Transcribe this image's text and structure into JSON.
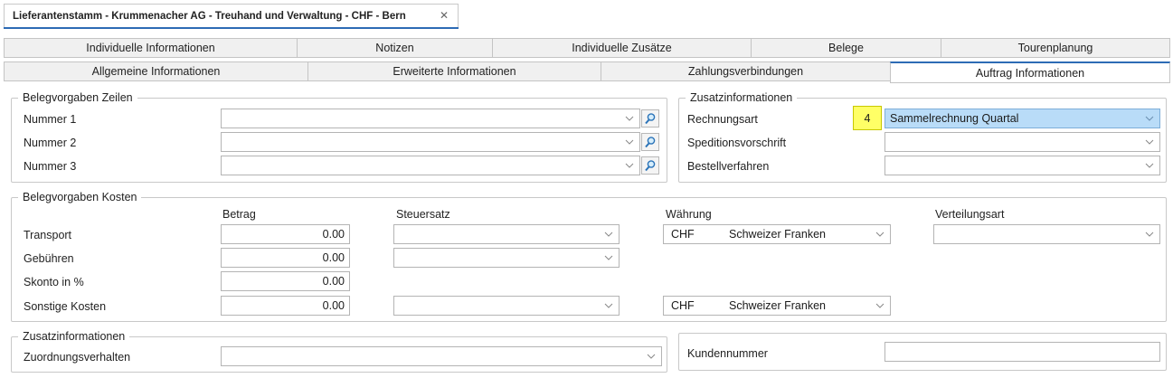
{
  "document": {
    "title": "Lieferantenstamm - Krummenacher AG - Treuhand und Verwaltung - CHF - Bern",
    "close_glyph": "✕"
  },
  "tabs_row1": [
    "Individuelle Informationen",
    "Notizen",
    "Individuelle Zusätze",
    "Belege",
    "Tourenplanung"
  ],
  "tabs_row2": [
    "Allgemeine Informationen",
    "Erweiterte Informationen",
    "Zahlungsverbindungen",
    "Auftrag Informationen"
  ],
  "active_tab": "Auftrag Informationen",
  "belegvorgaben_zeilen": {
    "title": "Belegvorgaben Zeilen",
    "rows": [
      {
        "label": "Nummer 1",
        "value": ""
      },
      {
        "label": "Nummer 2",
        "value": ""
      },
      {
        "label": "Nummer 3",
        "value": ""
      }
    ]
  },
  "zusatzinformationen_top": {
    "title": "Zusatzinformationen",
    "badge": "4",
    "rows": [
      {
        "label": "Rechnungsart",
        "value": "Sammelrechnung Quartal"
      },
      {
        "label": "Speditionsvorschrift",
        "value": ""
      },
      {
        "label": "Bestellverfahren",
        "value": ""
      }
    ]
  },
  "belegvorgaben_kosten": {
    "title": "Belegvorgaben Kosten",
    "headers": {
      "betrag": "Betrag",
      "steuersatz": "Steuersatz",
      "waehrung": "Währung",
      "verteilungsart": "Verteilungsart"
    },
    "rows": [
      {
        "label": "Transport",
        "betrag": "0.00",
        "steuersatz": "",
        "waehrung_code": "CHF",
        "waehrung_name": "Schweizer Franken",
        "verteilungsart": ""
      },
      {
        "label": "Gebühren",
        "betrag": "0.00",
        "steuersatz": ""
      },
      {
        "label": "Skonto in %",
        "betrag": "0.00"
      },
      {
        "label": "Sonstige Kosten",
        "betrag": "0.00",
        "steuersatz": "",
        "waehrung_code": "CHF",
        "waehrung_name": "Schweizer Franken"
      }
    ]
  },
  "zusatzinformationen_bottom": {
    "title": "Zusatzinformationen",
    "label": "Zuordnungsverhalten",
    "value": ""
  },
  "kunde": {
    "label": "Kundennummer",
    "value": ""
  },
  "icons": {
    "lookup": "magnifier-icon",
    "dropdown": "chevron-down-icon",
    "close": "close-icon"
  },
  "colors": {
    "accent": "#2d6bb5",
    "selection": "#b9dcf8",
    "badge": "#ffff66"
  }
}
